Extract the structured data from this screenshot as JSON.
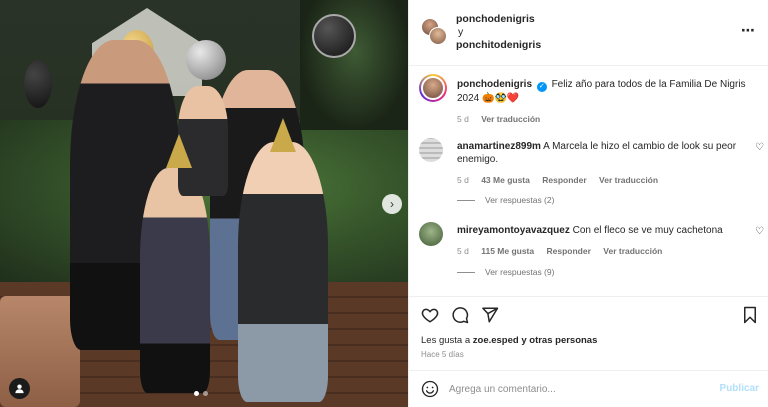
{
  "post": {
    "header": {
      "author_primary": "ponchodenigris",
      "conjunction": "y",
      "author_secondary": "ponchitodenigris",
      "more_icon": "more-horizontal-icon"
    },
    "caption": {
      "username": "ponchodenigris",
      "text": "Feliz año para todos de la Familia De Nigris 2024 🎃🥸❤️",
      "time": "5 d",
      "see_translation": "Ver traducción"
    },
    "comments": [
      {
        "username": "anamartinez899m",
        "text": "A Marcela le hizo el cambio de look su peor enemigo.",
        "time": "5 d",
        "likes": "43 Me gusta",
        "reply": "Responder",
        "see_translation": "Ver traducción",
        "view_replies": "Ver respuestas (2)"
      },
      {
        "username": "mireyamontoyavazquez",
        "text": "Con el fleco se ve muy cachetona",
        "time": "5 d",
        "likes": "115 Me gusta",
        "reply": "Responder",
        "see_translation": "Ver traducción",
        "view_replies": "Ver respuestas (9)"
      }
    ],
    "actions": {
      "icons": [
        "heart-icon",
        "comment-icon",
        "share-icon",
        "bookmark-icon"
      ],
      "likes_prefix": "Les gusta a ",
      "likes_user": "zoe.esped",
      "likes_suffix": " y otras personas",
      "timestamp": "Hace 5 días"
    },
    "composer": {
      "placeholder": "Agrega un comentario...",
      "publish": "Publicar"
    },
    "carousel": {
      "current_slide": 1,
      "total_slides": 2
    }
  },
  "colors": {
    "accent": "#0095f6",
    "publish_disabled": "#b2dffc",
    "heart": "#ed4956",
    "muted": "#8e8e8e"
  }
}
